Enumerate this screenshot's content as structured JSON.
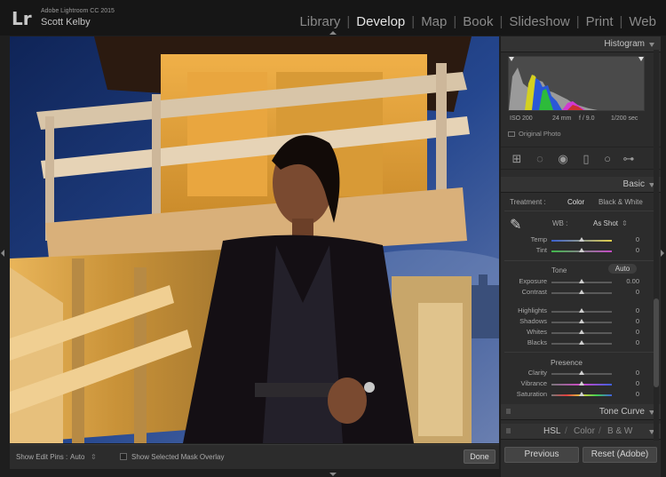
{
  "app": {
    "logo": "Lr",
    "name": "Adobe Lightroom CC 2015",
    "user": "Scott Kelby"
  },
  "modules": [
    {
      "label": "Library",
      "active": false
    },
    {
      "label": "Develop",
      "active": true
    },
    {
      "label": "Map",
      "active": false
    },
    {
      "label": "Book",
      "active": false
    },
    {
      "label": "Slideshow",
      "active": false
    },
    {
      "label": "Print",
      "active": false
    },
    {
      "label": "Web",
      "active": false
    }
  ],
  "toolbar": {
    "edit_pins_label": "Show Edit Pins :",
    "edit_pins_value": "Auto",
    "mask_overlay_label": "Show Selected Mask Overlay",
    "done_label": "Done"
  },
  "histogram": {
    "title": "Histogram",
    "iso": "ISO 200",
    "focal": "24 mm",
    "aperture": "f / 9.0",
    "shutter": "1/200 sec",
    "original_photo": "Original Photo"
  },
  "basic": {
    "title": "Basic",
    "treatment_label": "Treatment :",
    "treatment_color": "Color",
    "treatment_bw": "Black & White",
    "wb_label": "WB :",
    "wb_value": "As Shot",
    "tone_label": "Tone",
    "auto_label": "Auto",
    "presence_label": "Presence",
    "sliders": [
      {
        "label": "Temp",
        "value": "0",
        "pos": 0.5
      },
      {
        "label": "Tint",
        "value": "0",
        "pos": 0.5
      },
      {
        "label": "Exposure",
        "value": "0.00",
        "pos": 0.5
      },
      {
        "label": "Contrast",
        "value": "0",
        "pos": 0.5
      },
      {
        "label": "Highlights",
        "value": "0",
        "pos": 0.5
      },
      {
        "label": "Shadows",
        "value": "0",
        "pos": 0.5
      },
      {
        "label": "Whites",
        "value": "0",
        "pos": 0.5
      },
      {
        "label": "Blacks",
        "value": "0",
        "pos": 0.5
      },
      {
        "label": "Clarity",
        "value": "0",
        "pos": 0.5
      },
      {
        "label": "Vibrance",
        "value": "0",
        "pos": 0.5
      },
      {
        "label": "Saturation",
        "value": "0",
        "pos": 0.5
      }
    ]
  },
  "tone_curve": {
    "title": "Tone Curve"
  },
  "hsl": {
    "hsl": "HSL",
    "color": "Color",
    "bw": "B & W",
    "sep": "/"
  },
  "buttons": {
    "previous": "Previous",
    "reset": "Reset (Adobe)"
  },
  "icons": [
    "crop-overlay-icon",
    "spot-removal-icon",
    "red-eye-icon",
    "graduated-filter-icon",
    "radial-filter-icon",
    "adjustment-brush-icon",
    "wb-eyedropper-icon"
  ]
}
